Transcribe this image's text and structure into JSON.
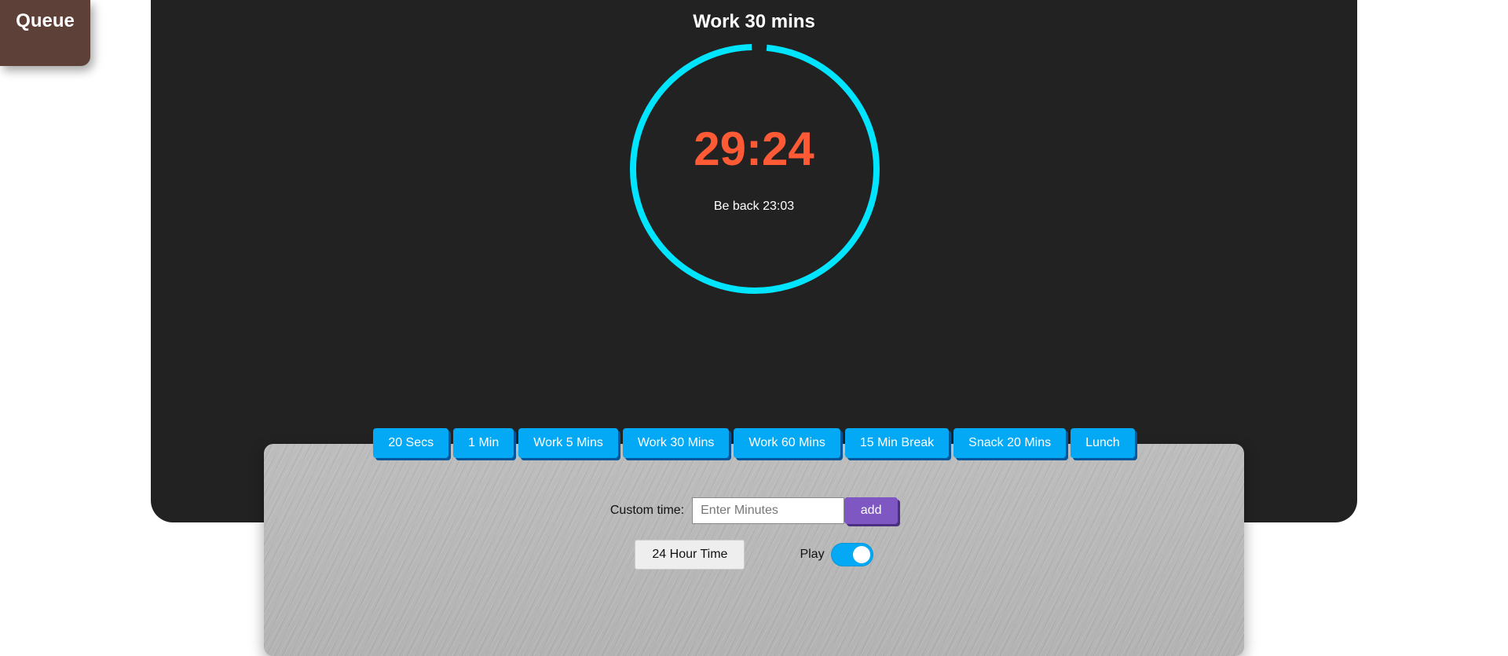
{
  "queue": {
    "label": "Queue"
  },
  "timer": {
    "title": "Work 30 mins",
    "time": "29:24",
    "be_back": "Be back 23:03",
    "progress": 0.98,
    "ring_color": "#00e5ff",
    "time_color": "#ff5a36"
  },
  "presets": [
    {
      "label": "20 Secs"
    },
    {
      "label": "1 Min"
    },
    {
      "label": "Work 5 Mins"
    },
    {
      "label": "Work 30 Mins"
    },
    {
      "label": "Work 60 Mins"
    },
    {
      "label": "15 Min Break"
    },
    {
      "label": "Snack 20 Mins"
    },
    {
      "label": "Lunch"
    }
  ],
  "custom": {
    "label": "Custom time:",
    "placeholder": "Enter Minutes",
    "value": "",
    "add_label": "add"
  },
  "options": {
    "hour_label": "24 Hour Time",
    "play_label": "Play",
    "play_on": true
  },
  "colors": {
    "accent": "#03a9f4",
    "add_button": "#7e57c2",
    "queue_tab": "#5d4037",
    "panel_dark": "#222222"
  }
}
